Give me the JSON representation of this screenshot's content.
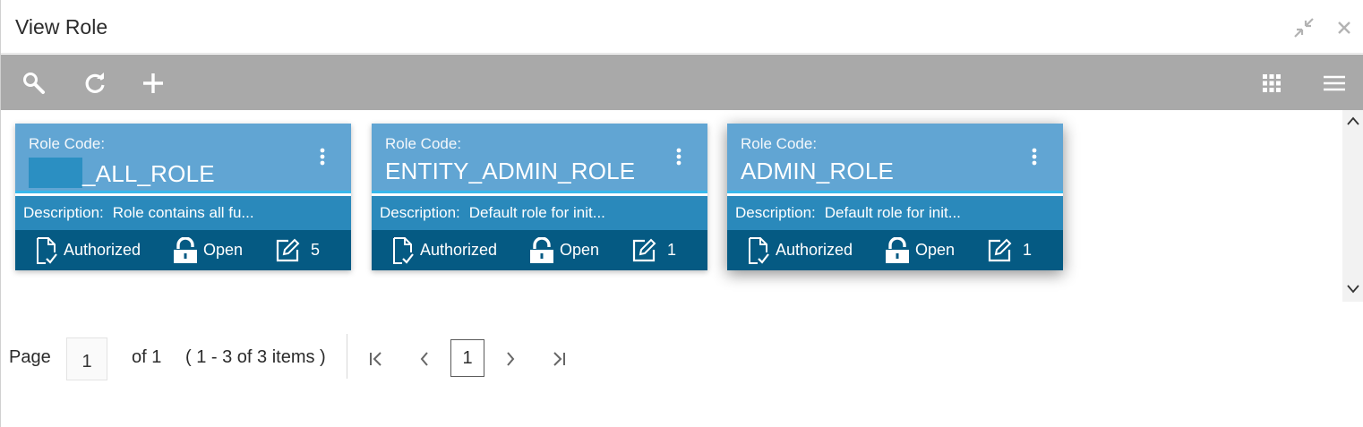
{
  "window": {
    "title": "View Role",
    "controls": {
      "minimize_icon": "collapse-arrows-icon",
      "close_icon": "close-icon"
    }
  },
  "toolbar": {
    "left_buttons": [
      "search-icon",
      "refresh-icon",
      "add-icon"
    ],
    "right_buttons": [
      "grid-view-icon",
      "list-view-icon"
    ]
  },
  "cards": [
    {
      "code_label": "Role Code:",
      "code_value": "_ALL_ROLE",
      "code_masked_prefix": true,
      "description_label": "Description:",
      "description_value": "Role contains all fu...",
      "status": "Authorized",
      "lock": "Open",
      "modifications": "5"
    },
    {
      "code_label": "Role Code:",
      "code_value": "ENTITY_ADMIN_ROLE",
      "code_masked_prefix": false,
      "description_label": "Description:",
      "description_value": "Default role for init...",
      "status": "Authorized",
      "lock": "Open",
      "modifications": "1"
    },
    {
      "code_label": "Role Code:",
      "code_value": "ADMIN_ROLE",
      "code_masked_prefix": false,
      "description_label": "Description:",
      "description_value": "Default role for init...",
      "status": "Authorized",
      "lock": "Open",
      "modifications": "1"
    }
  ],
  "pagination": {
    "page_label": "Page",
    "page_value": "1",
    "of_label": "of 1",
    "range_label": "( 1 - 3 of 3 items )",
    "current_page": "1"
  },
  "colors": {
    "card_head": "#61a5d3",
    "card_desc": "#2a89bb",
    "card_foot": "#055a83",
    "toolbar": "#a9a9a9"
  }
}
